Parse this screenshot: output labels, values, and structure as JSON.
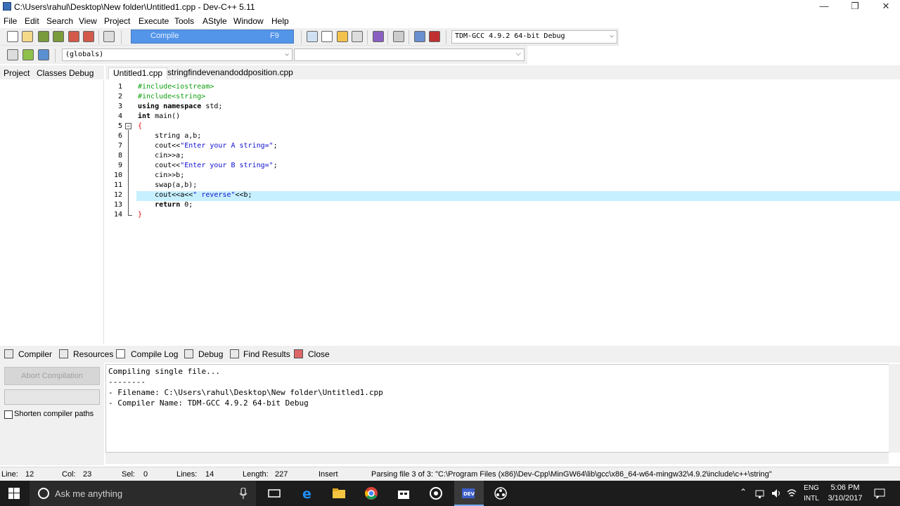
{
  "window": {
    "title": "C:\\Users\\rahul\\Desktop\\New folder\\Untitled1.cpp - Dev-C++ 5.11",
    "minimize": "—",
    "restore": "❐",
    "close": "✕"
  },
  "menu": [
    "File",
    "Edit",
    "Search",
    "View",
    "Project",
    "Execute",
    "Tools",
    "AStyle",
    "Window",
    "Help"
  ],
  "toolbar": {
    "compile_tooltip": "Compile",
    "compile_shortcut": "F9",
    "compiler": "TDM-GCC 4.9.2 64-bit Debug",
    "scope": "(globals)"
  },
  "left_tabs": [
    "Project",
    "Classes",
    "Debug"
  ],
  "file_tabs": [
    "Untitled1.cpp",
    "stringfindevenandoddposition.cpp"
  ],
  "code": {
    "line_numbers": [
      "1",
      "2",
      "3",
      "4",
      "5",
      "6",
      "7",
      "8",
      "9",
      "10",
      "11",
      "12",
      "13",
      "14"
    ],
    "highlighted_line": "12"
  },
  "bottom_tabs": [
    "Compiler",
    "Resources",
    "Compile Log",
    "Debug",
    "Find Results",
    "Close"
  ],
  "compile_panel": {
    "abort_label": "Abort Compilation",
    "shorten_label": "Shorten compiler paths"
  },
  "log": [
    "Compiling single file...",
    "--------",
    "- Filename: C:\\Users\\rahul\\Desktop\\New folder\\Untitled1.cpp",
    "- Compiler Name: TDM-GCC 4.9.2 64-bit Debug"
  ],
  "status": {
    "line_label": "Line:",
    "line": "12",
    "col_label": "Col:",
    "col": "23",
    "sel_label": "Sel:",
    "sel": "0",
    "lines_label": "Lines:",
    "lines": "14",
    "length_label": "Length:",
    "length": "227",
    "mode": "Insert",
    "message": "Parsing file 3 of 3: \"C:\\Program Files (x86)\\Dev-Cpp\\MinGW64\\lib\\gcc\\x86_64-w64-mingw32\\4.9.2\\include\\c++\\string\""
  },
  "taskbar": {
    "search_placeholder": "Ask me anything",
    "lang_top": "ENG",
    "lang_bottom": "INTL",
    "time": "5:06 PM",
    "date": "3/10/2017"
  }
}
